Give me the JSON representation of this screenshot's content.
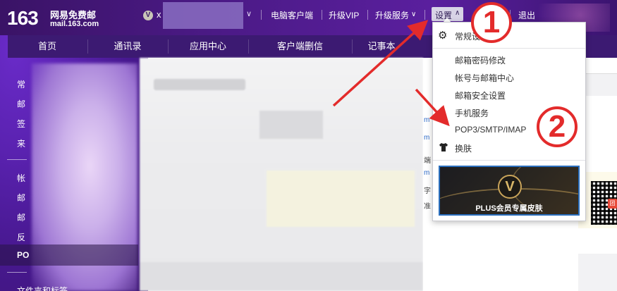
{
  "header": {
    "logo_number": "163",
    "logo_cn": "网易免费邮",
    "logo_domain": "mail.163.com",
    "vip_badge": "V",
    "user_initial": "x",
    "links": [
      "电脑客户端",
      "升级VIP",
      "升级服务",
      "退出"
    ],
    "settings_label": "设置",
    "colors": {
      "accent": "#4b1a86",
      "nav": "#3c1a72"
    }
  },
  "nav": {
    "items": [
      "首页",
      "通讯录",
      "应用中心",
      "客户端删信",
      "记事本"
    ]
  },
  "sidebar": {
    "items": [
      "常",
      "邮",
      "签",
      "来",
      "帐",
      "邮",
      "邮",
      "反",
      "PO",
      "文件夹和标签"
    ]
  },
  "right": {
    "texts": [
      "m",
      "m",
      "端",
      "m",
      "字",
      "准"
    ],
    "qr_tag": "团"
  },
  "dropdown": {
    "items": [
      {
        "label": "常规设",
        "icon": "gear-icon"
      },
      {
        "label": "邮箱密码修改"
      },
      {
        "label": "帐号与邮箱中心"
      },
      {
        "label": "邮箱安全设置"
      },
      {
        "label": "手机服务"
      },
      {
        "label": "POP3/SMTP/IMAP"
      },
      {
        "label": "换肤",
        "icon": "shirt-icon"
      }
    ],
    "promo": {
      "badge": "V",
      "label": "PLUS会员专属皮肤"
    }
  },
  "annotations": {
    "step1": "1",
    "step2": "2",
    "color": "#e32b2b"
  }
}
